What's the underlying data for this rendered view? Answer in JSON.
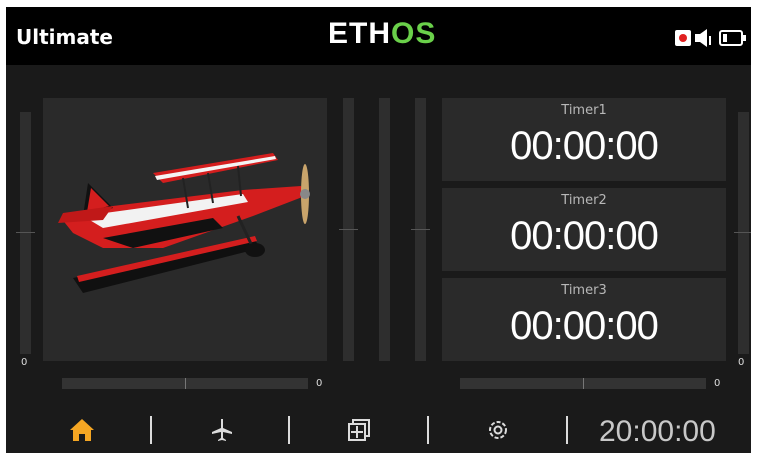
{
  "header": {
    "model_name": "Ultimate",
    "brand_main": "ETH",
    "brand_accent": "OS",
    "brand_accent_color": "#6ad04a",
    "icons": [
      "record-icon",
      "speaker-icon",
      "battery-icon"
    ]
  },
  "model": {
    "image_icon": "biplane-model-image"
  },
  "trims": {
    "left_vertical_value": "0",
    "left_horizontal_value": "0",
    "right_horizontal_value": "0",
    "right_vertical_value": "0"
  },
  "timers": [
    {
      "name": "Timer1",
      "value": "00:00:00"
    },
    {
      "name": "Timer2",
      "value": "00:00:00"
    },
    {
      "name": "Timer3",
      "value": "00:00:00"
    }
  ],
  "bottom_nav": {
    "items": [
      "home-icon",
      "airplane-icon",
      "layout-icon",
      "settings-icon"
    ],
    "active_color": "#f5a623",
    "clock": "20:00:00"
  }
}
